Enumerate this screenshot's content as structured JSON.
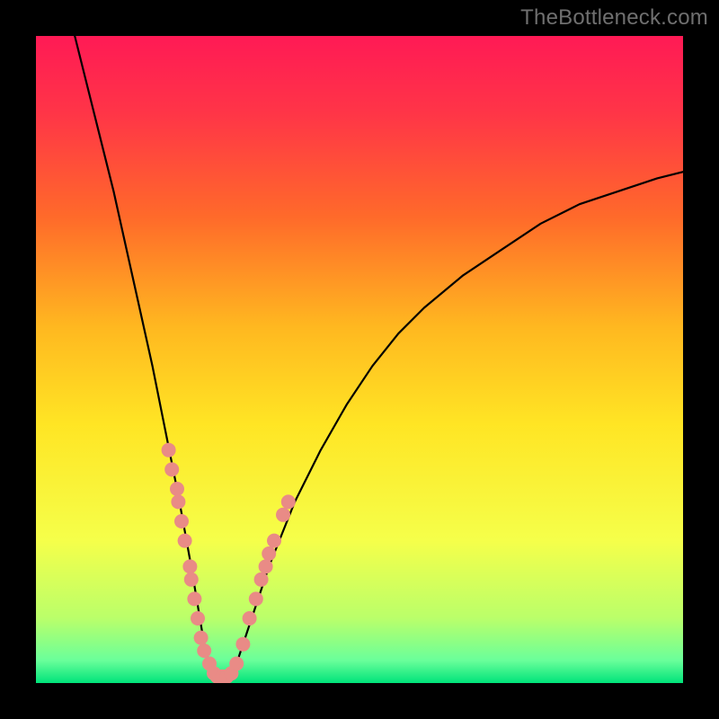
{
  "watermark": "TheBottleneck.com",
  "colors": {
    "frame": "#000000",
    "gradient_stops": [
      {
        "offset": 0.0,
        "color": "#ff1a55"
      },
      {
        "offset": 0.12,
        "color": "#ff3547"
      },
      {
        "offset": 0.28,
        "color": "#ff6a2a"
      },
      {
        "offset": 0.45,
        "color": "#ffb820"
      },
      {
        "offset": 0.6,
        "color": "#ffe524"
      },
      {
        "offset": 0.78,
        "color": "#f5ff4a"
      },
      {
        "offset": 0.9,
        "color": "#baff6a"
      },
      {
        "offset": 0.965,
        "color": "#6aff9a"
      },
      {
        "offset": 1.0,
        "color": "#00e37a"
      }
    ],
    "curve": "#000000",
    "marker_fill": "#e98b86",
    "marker_stroke": "#c75f5a"
  },
  "chart_data": {
    "type": "line",
    "title": "",
    "xlabel": "",
    "ylabel": "",
    "xlim": [
      0,
      100
    ],
    "ylim": [
      0,
      100
    ],
    "x_min_at": 28,
    "curve": [
      {
        "x": 6,
        "y": 100
      },
      {
        "x": 8,
        "y": 92
      },
      {
        "x": 10,
        "y": 84
      },
      {
        "x": 12,
        "y": 76
      },
      {
        "x": 14,
        "y": 67
      },
      {
        "x": 16,
        "y": 58
      },
      {
        "x": 18,
        "y": 49
      },
      {
        "x": 20,
        "y": 39
      },
      {
        "x": 22,
        "y": 29
      },
      {
        "x": 24,
        "y": 18
      },
      {
        "x": 25,
        "y": 12
      },
      {
        "x": 26,
        "y": 6
      },
      {
        "x": 27,
        "y": 2
      },
      {
        "x": 28,
        "y": 0
      },
      {
        "x": 29,
        "y": 0
      },
      {
        "x": 30,
        "y": 1
      },
      {
        "x": 31,
        "y": 3
      },
      {
        "x": 32,
        "y": 6
      },
      {
        "x": 34,
        "y": 12
      },
      {
        "x": 36,
        "y": 18
      },
      {
        "x": 38,
        "y": 23
      },
      {
        "x": 40,
        "y": 28
      },
      {
        "x": 44,
        "y": 36
      },
      {
        "x": 48,
        "y": 43
      },
      {
        "x": 52,
        "y": 49
      },
      {
        "x": 56,
        "y": 54
      },
      {
        "x": 60,
        "y": 58
      },
      {
        "x": 66,
        "y": 63
      },
      {
        "x": 72,
        "y": 67
      },
      {
        "x": 78,
        "y": 71
      },
      {
        "x": 84,
        "y": 74
      },
      {
        "x": 90,
        "y": 76
      },
      {
        "x": 96,
        "y": 78
      },
      {
        "x": 100,
        "y": 79
      }
    ],
    "markers": [
      {
        "x": 20.5,
        "y": 36
      },
      {
        "x": 21.0,
        "y": 33
      },
      {
        "x": 21.8,
        "y": 30
      },
      {
        "x": 22.0,
        "y": 28
      },
      {
        "x": 22.5,
        "y": 25
      },
      {
        "x": 23.0,
        "y": 22
      },
      {
        "x": 23.8,
        "y": 18
      },
      {
        "x": 24.0,
        "y": 16
      },
      {
        "x": 24.5,
        "y": 13
      },
      {
        "x": 25.0,
        "y": 10
      },
      {
        "x": 25.5,
        "y": 7
      },
      {
        "x": 26.0,
        "y": 5
      },
      {
        "x": 26.8,
        "y": 3
      },
      {
        "x": 27.5,
        "y": 1.5
      },
      {
        "x": 28.0,
        "y": 1
      },
      {
        "x": 28.8,
        "y": 1
      },
      {
        "x": 29.5,
        "y": 1
      },
      {
        "x": 30.2,
        "y": 1.5
      },
      {
        "x": 31.0,
        "y": 3
      },
      {
        "x": 32.0,
        "y": 6
      },
      {
        "x": 33.0,
        "y": 10
      },
      {
        "x": 34.0,
        "y": 13
      },
      {
        "x": 34.8,
        "y": 16
      },
      {
        "x": 35.5,
        "y": 18
      },
      {
        "x": 36.0,
        "y": 20
      },
      {
        "x": 36.8,
        "y": 22
      },
      {
        "x": 38.2,
        "y": 26
      },
      {
        "x": 39.0,
        "y": 28
      }
    ]
  }
}
